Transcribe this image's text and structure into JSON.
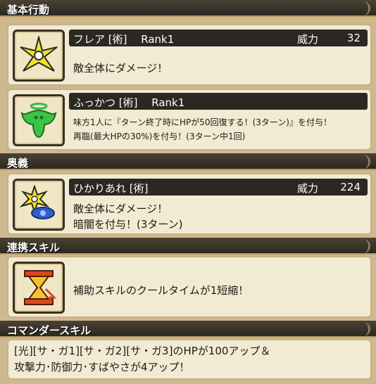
{
  "sections": {
    "basic": "基本行動",
    "ougi": "奥義",
    "renkei": "連携スキル",
    "commander": "コマンダースキル"
  },
  "skills": {
    "flare": {
      "name": "フレア [術]　 Rank1",
      "power_label": "威力",
      "power_value": "32",
      "desc": "敵全体にダメージ！"
    },
    "fukkatsu": {
      "name": "ふっかつ [術]　 Rank1",
      "desc": "味方1人に『ターン終了時にHPが50回復する！(3ターン)』を付与！\n再臨(最大HPの30%)を付与！(3ターン中1回)"
    },
    "hikari": {
      "name": "ひかりあれ [術]",
      "power_label": "威力",
      "power_value": "224",
      "desc": "敵全体にダメージ！\n暗闇を付与！(3ターン)"
    },
    "renkei": {
      "desc": "補助スキルのクールタイムが1短縮！"
    },
    "commander": {
      "desc": "[光][サ・ガ1][サ・ガ2][サ・ガ3]のHPが100アップ＆\n攻撃力･防御力･すばやさが4アップ！"
    }
  },
  "colors": {
    "background": "#cdb890",
    "header": "#2c2820",
    "card": "#f0ebd2",
    "name_bar": "#2b2722"
  },
  "icons": [
    "flare-shuriken-icon",
    "angel-revive-icon",
    "shuriken-eye-icon",
    "hourglass-icon"
  ]
}
